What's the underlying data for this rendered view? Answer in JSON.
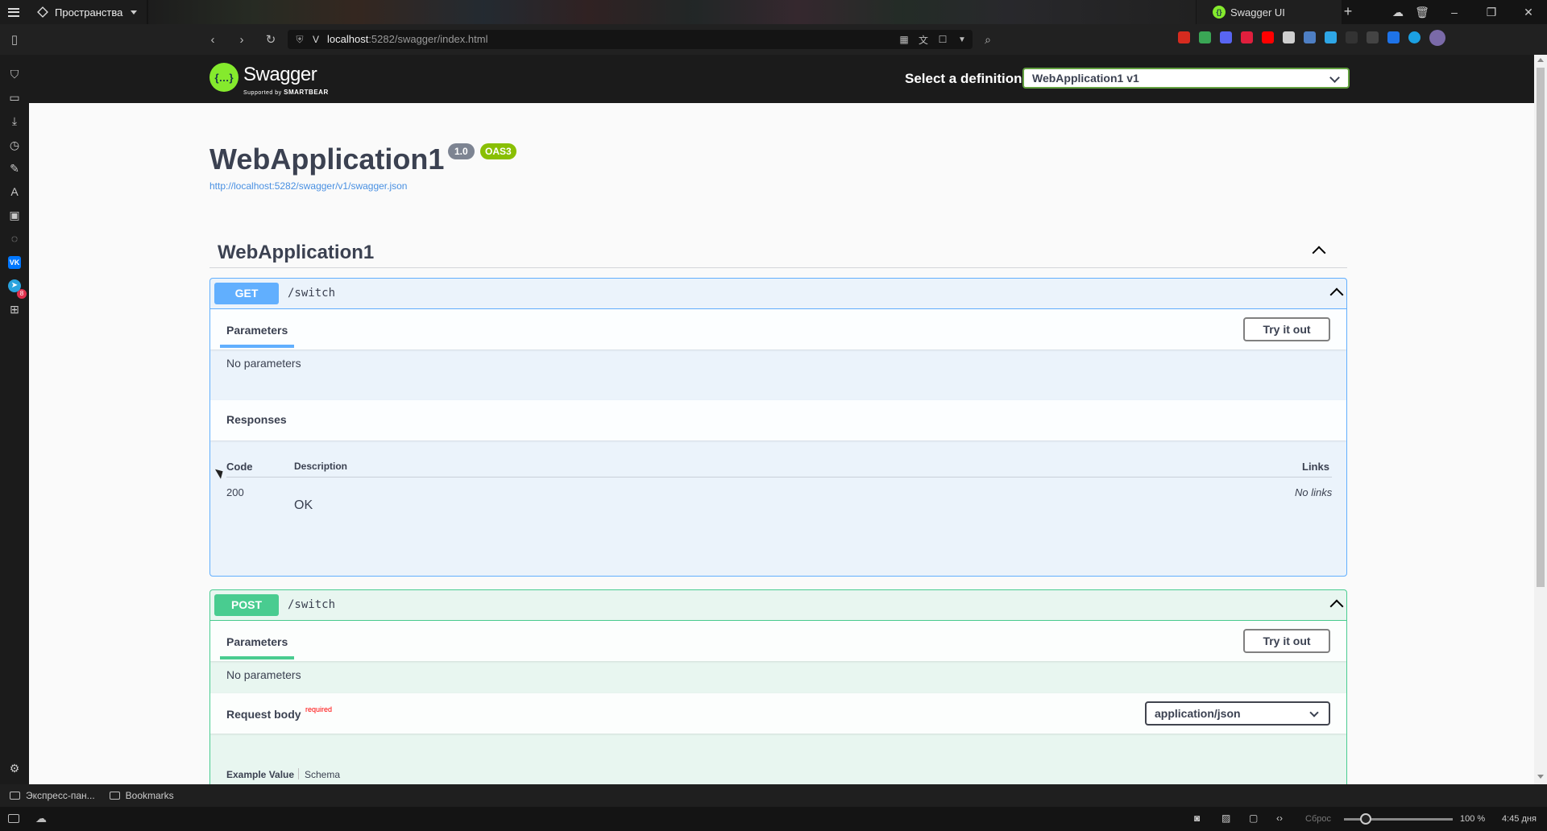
{
  "browser": {
    "spaces_label": "Пространства",
    "active_tab_title": "Swagger UI",
    "url_host": "localhost",
    "url_rest": ":5282/swagger/index.html",
    "sidebar_badge": "8",
    "bookmarks": [
      "Экспресс-пан...",
      "Bookmarks"
    ],
    "status": {
      "reset_label": "Сброс",
      "zoom": "100 %",
      "time": "4:45 дня"
    }
  },
  "swagger": {
    "logo_text": "Swagger",
    "logo_sub_prefix": "Supported by",
    "logo_sub_brand": "SMARTBEAR",
    "select_label": "Select a definition",
    "definition_selected": "WebApplication1 v1",
    "api_title": "WebApplication1",
    "version": "1.0",
    "oas": "OAS3",
    "spec_url": "http://localhost:5282/swagger/v1/swagger.json",
    "tag": "WebApplication1",
    "operations": [
      {
        "method": "GET",
        "path": "/switch",
        "parameters_label": "Parameters",
        "try_label": "Try it out",
        "no_params": "No parameters",
        "responses_label": "Responses",
        "columns": [
          "Code",
          "Description",
          "Links"
        ],
        "responses": [
          {
            "code": "200",
            "description": "OK",
            "links": "No links"
          }
        ]
      },
      {
        "method": "POST",
        "path": "/switch",
        "parameters_label": "Parameters",
        "try_label": "Try it out",
        "no_params": "No parameters",
        "request_body_label": "Request body",
        "required_label": "required",
        "content_type": "application/json",
        "example_value_label": "Example Value",
        "schema_label": "Schema"
      }
    ]
  },
  "colors": {
    "get": "#61affe",
    "post": "#49cc90",
    "swagger_green": "#85ea2d",
    "oas_badge": "#89bf04"
  }
}
